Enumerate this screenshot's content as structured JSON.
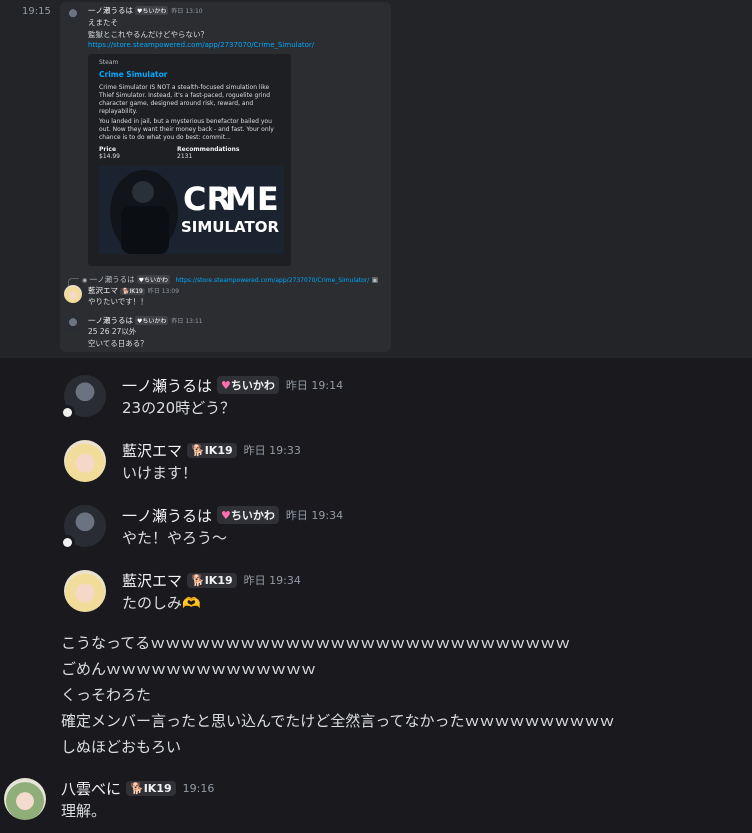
{
  "quoted": {
    "time": "19:15",
    "msg1": {
      "user": "一ノ瀬うるは",
      "tag": "ちいかわ",
      "time": "昨日 13:10",
      "lines": [
        "えまたそ",
        "監獄とこれやるんだけどやらない？"
      ],
      "link": "https://store.steampowered.com/app/2737070/Crime_Simulator/"
    },
    "embed": {
      "provider": "Steam",
      "title": "Crime Simulator",
      "description": "Crime Simulator IS NOT a stealth-focused simulation like Thief Simulator. Instead, it's a fast-paced, roguelite grind character game, designed around risk, reward, and replayability.",
      "description2": "You landed in jail, but a mysterious benefactor bailed you out. Now they want their money back - and fast. Your only chance is to do what you do best: commit...",
      "price_label": "Price",
      "price_value": "$14.99",
      "rec_label": "Recommendations",
      "rec_value": "2131",
      "image_text_1": "CR",
      "image_text_2": "ME",
      "image_text_3": "SIMULATOR"
    },
    "reply_ref": {
      "user": "一ノ瀬うるは",
      "tag": "ちいかわ",
      "link": "https://store.steampowered.com/app/2737070/Crime_Simulator/"
    },
    "msg2": {
      "user": "藍沢エマ",
      "tag": "IK19",
      "time": "昨日 13:09",
      "text": "やりたいです！！"
    },
    "msg3": {
      "user": "一ノ瀬うるは",
      "tag": "ちいかわ",
      "time": "昨日 13:11",
      "lines": [
        "25 26 27以外",
        "空いてる日ある？"
      ]
    }
  },
  "messages": [
    {
      "user": "一ノ瀬うるは",
      "tag": "ちいかわ",
      "time": "昨日 19:14",
      "text": "23の20時どう？"
    },
    {
      "user": "藍沢エマ",
      "tag": "IK19",
      "time": "昨日 19:33",
      "text": "いけます！"
    },
    {
      "user": "一ノ瀬うるは",
      "tag": "ちいかわ",
      "time": "昨日 19:34",
      "text": "やた！やろう～"
    },
    {
      "user": "藍沢エマ",
      "tag": "IK19",
      "time": "昨日 19:34",
      "text": "たのしみ",
      "emoji": "🫶"
    }
  ],
  "followups": [
    "こうなってるｗｗｗｗｗｗｗｗｗｗｗｗｗｗｗｗｗｗｗｗｗｗｗｗｗｗｗｗ",
    "ごめんｗｗｗｗｗｗｗｗｗｗｗｗｗｗ",
    "くっそわろた",
    "確定メンバー言ったと思い込んでたけど全然言ってなかったｗｗｗｗｗｗｗｗｗｗ",
    "しぬほどおもろい"
  ],
  "last": {
    "user": "八雲べに",
    "tag": "IK19",
    "time": "19:16",
    "text": "理解。"
  },
  "colors": {
    "background": "#1a1a1e",
    "link": "#00a8fc",
    "accent_heart": "#ff6fb0"
  }
}
